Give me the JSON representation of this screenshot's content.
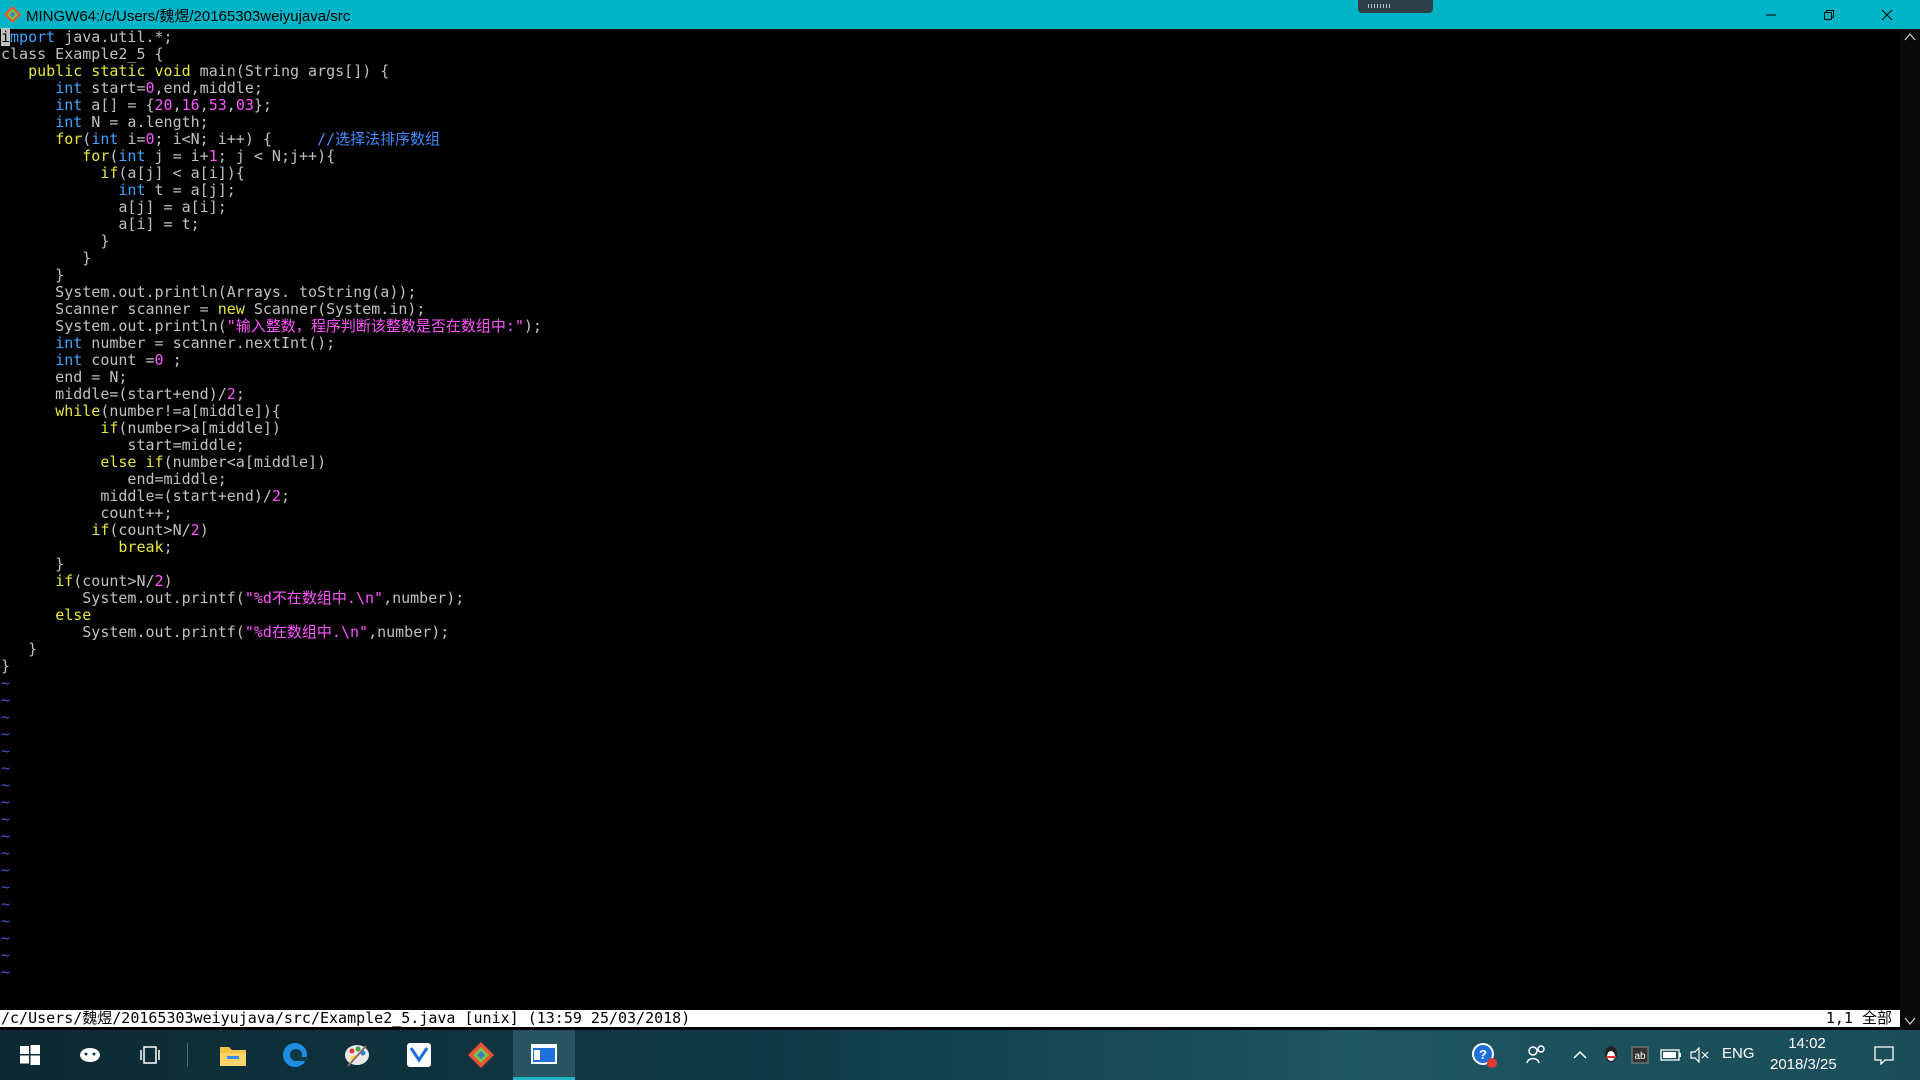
{
  "window": {
    "title": "MINGW64:/c/Users/魏煜/20165303weiyujava/src"
  },
  "editor": {
    "lines": [
      [
        [
          "cursor",
          "i"
        ],
        [
          "ty",
          "mport"
        ],
        [
          "t",
          " java.util.*;"
        ]
      ],
      [
        [
          "t",
          "class Example2_5 {"
        ]
      ],
      [
        [
          "t",
          "   "
        ],
        [
          "kw",
          "public static void"
        ],
        [
          "t",
          " main(String args[]) {"
        ]
      ],
      [
        [
          "t",
          "      "
        ],
        [
          "ty",
          "int"
        ],
        [
          "t",
          " start="
        ],
        [
          "num",
          "0"
        ],
        [
          "t",
          ",end,middle;"
        ]
      ],
      [
        [
          "t",
          "      "
        ],
        [
          "ty",
          "int"
        ],
        [
          "t",
          " a[] = {"
        ],
        [
          "num",
          "20"
        ],
        [
          "t",
          ","
        ],
        [
          "num",
          "16"
        ],
        [
          "t",
          ","
        ],
        [
          "num",
          "53"
        ],
        [
          "t",
          ","
        ],
        [
          "num",
          "03"
        ],
        [
          "t",
          "};"
        ]
      ],
      [
        [
          "t",
          "      "
        ],
        [
          "ty",
          "int"
        ],
        [
          "t",
          " N = a.length;"
        ]
      ],
      [
        [
          "t",
          "      "
        ],
        [
          "kw",
          "for"
        ],
        [
          "t",
          "("
        ],
        [
          "ty",
          "int"
        ],
        [
          "t",
          " i="
        ],
        [
          "num",
          "0"
        ],
        [
          "t",
          "; i<N; i++) {     "
        ],
        [
          "cm",
          "//选择法排序数组"
        ]
      ],
      [
        [
          "t",
          "         "
        ],
        [
          "kw",
          "for"
        ],
        [
          "t",
          "("
        ],
        [
          "ty",
          "int"
        ],
        [
          "t",
          " j = i+"
        ],
        [
          "num",
          "1"
        ],
        [
          "t",
          "; j < N;j++){"
        ]
      ],
      [
        [
          "t",
          "           "
        ],
        [
          "kw",
          "if"
        ],
        [
          "t",
          "(a[j] < a[i]){"
        ]
      ],
      [
        [
          "t",
          "             "
        ],
        [
          "ty",
          "int"
        ],
        [
          "t",
          " t = a[j];"
        ]
      ],
      [
        [
          "t",
          "             a[j] = a[i];"
        ]
      ],
      [
        [
          "t",
          "             a[i] = t;"
        ]
      ],
      [
        [
          "t",
          "           }"
        ]
      ],
      [
        [
          "t",
          "         }"
        ]
      ],
      [
        [
          "t",
          "      }"
        ]
      ],
      [
        [
          "t",
          "      System.out.println(Arrays. toString(a));"
        ]
      ],
      [
        [
          "t",
          "      Scanner scanner = "
        ],
        [
          "kw",
          "new"
        ],
        [
          "t",
          " Scanner(System.in);"
        ]
      ],
      [
        [
          "t",
          "      System.out.println("
        ],
        [
          "str",
          "\"输入整数，程序判断该整数是否在数组中:\""
        ],
        [
          "t",
          ");"
        ]
      ],
      [
        [
          "t",
          "      "
        ],
        [
          "ty",
          "int"
        ],
        [
          "t",
          " number = scanner.nextInt();"
        ]
      ],
      [
        [
          "t",
          "      "
        ],
        [
          "ty",
          "int"
        ],
        [
          "t",
          " count ="
        ],
        [
          "num",
          "0"
        ],
        [
          "t",
          " ;"
        ]
      ],
      [
        [
          "t",
          "      end = N;"
        ]
      ],
      [
        [
          "t",
          "      middle=(start+end)/"
        ],
        [
          "num",
          "2"
        ],
        [
          "t",
          ";"
        ]
      ],
      [
        [
          "t",
          "      "
        ],
        [
          "kw",
          "while"
        ],
        [
          "t",
          "(number!=a[middle]){"
        ]
      ],
      [
        [
          "t",
          "           "
        ],
        [
          "kw",
          "if"
        ],
        [
          "t",
          "(number>a[middle])"
        ]
      ],
      [
        [
          "t",
          "              start=middle;"
        ]
      ],
      [
        [
          "t",
          "           "
        ],
        [
          "kw",
          "else if"
        ],
        [
          "t",
          "(number<a[middle])"
        ]
      ],
      [
        [
          "t",
          "              end=middle;"
        ]
      ],
      [
        [
          "t",
          "           middle=(start+end)/"
        ],
        [
          "num",
          "2"
        ],
        [
          "t",
          ";"
        ]
      ],
      [
        [
          "t",
          "           count++;"
        ]
      ],
      [
        [
          "t",
          "          "
        ],
        [
          "kw",
          "if"
        ],
        [
          "t",
          "(count>N/"
        ],
        [
          "num",
          "2"
        ],
        [
          "t",
          ")"
        ]
      ],
      [
        [
          "t",
          "             "
        ],
        [
          "kw",
          "break"
        ],
        [
          "t",
          ";"
        ]
      ],
      [
        [
          "t",
          "      }"
        ]
      ],
      [
        [
          "t",
          "      "
        ],
        [
          "kw",
          "if"
        ],
        [
          "t",
          "(count>N/"
        ],
        [
          "num",
          "2"
        ],
        [
          "t",
          ")"
        ]
      ],
      [
        [
          "t",
          "         System.out.printf("
        ],
        [
          "str",
          "\"%d不在数组中.\\n\""
        ],
        [
          "t",
          ",number);"
        ]
      ],
      [
        [
          "t",
          "      "
        ],
        [
          "kw",
          "else"
        ]
      ],
      [
        [
          "t",
          "         System.out.printf("
        ],
        [
          "str",
          "\"%d在数组中.\\n\""
        ],
        [
          "t",
          ",number);"
        ]
      ],
      [
        [
          "t",
          "   }"
        ]
      ],
      [
        [
          "t",
          "}"
        ]
      ]
    ],
    "tilde_count": 18,
    "tilde_char": "~"
  },
  "statusline": {
    "left": "/c/Users/魏煜/20165303weiyujava/src/Example2_5.java [unix] (13:59 25/03/2018)",
    "right": "1,1 全部"
  },
  "taskbar": {
    "language": "ENG",
    "time": "14:02",
    "date": "2018/3/25",
    "icons": [
      "windows-start-icon",
      "cortana-icon",
      "task-view-icon",
      "file-explorer-icon",
      "edge-browser-icon",
      "paint-icon",
      "feishu-app-icon",
      "git-icon",
      "terminal-icon"
    ]
  },
  "colors": {
    "titlebar": "#00b4c8",
    "keyword": "#e6e63c",
    "type": "#3fa4ff",
    "literal": "#ff55ff",
    "comment": "#3f8cff",
    "tilde": "#3f5bd6"
  }
}
